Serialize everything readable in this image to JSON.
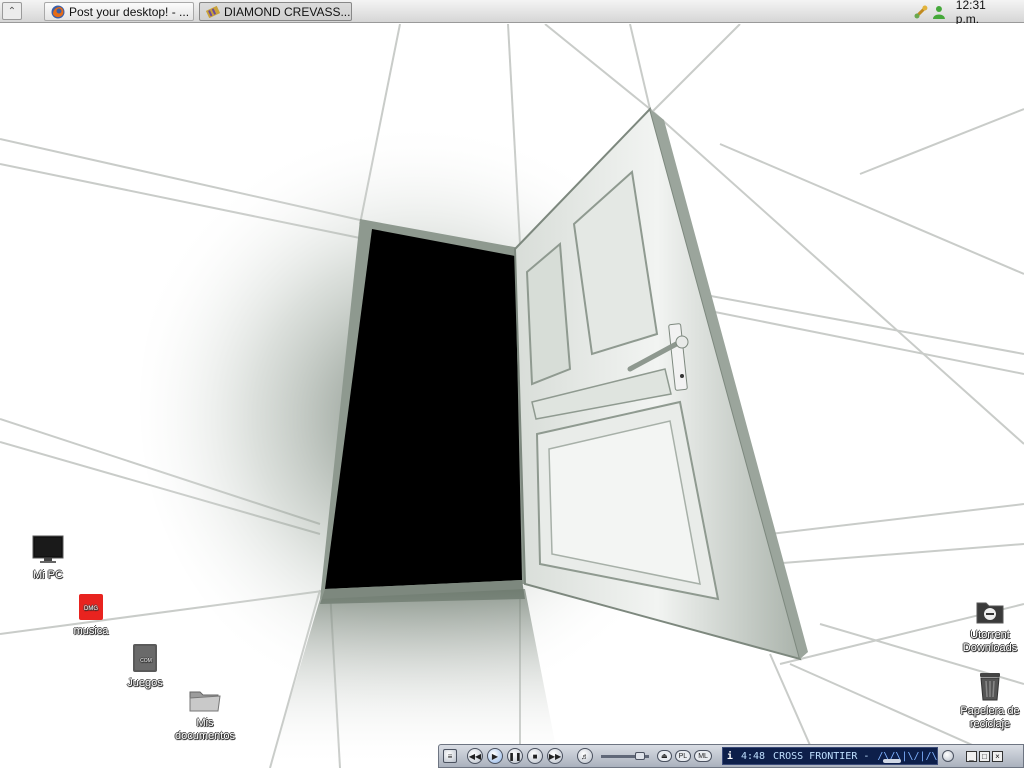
{
  "taskbar": {
    "tasks": [
      {
        "label": "Post your desktop! - ...",
        "icon": "firefox-icon"
      },
      {
        "label": "DIAMOND CREVASS...",
        "icon": "winrar-icon"
      }
    ],
    "clock": "12:31 p.m.",
    "tray_icons": [
      "network-icon",
      "messenger-user-icon"
    ]
  },
  "desktop": {
    "icons_left": [
      {
        "label": "Mi PC",
        "icon": "monitor-icon"
      },
      {
        "label": "musica",
        "icon": "music-folder-icon"
      },
      {
        "label": "Juegos",
        "icon": "games-folder-icon"
      },
      {
        "label": "Mis documentos",
        "icon": "documents-folder-icon"
      }
    ],
    "icons_right": [
      {
        "label": "Utorrent Downloads",
        "icon": "downloads-folder-icon"
      },
      {
        "label": "Papelera de reciclaje",
        "icon": "recycle-bin-icon"
      }
    ]
  },
  "player": {
    "time": "4:48",
    "track": "CROSS FRONTIER -",
    "pl_label": "PL",
    "ml_label": "ML"
  },
  "colors": {
    "taskbar_bg": "#e2e2e2",
    "door_shadow": "#000000",
    "door_tint": "#7d8a7e",
    "lcd_bg": "#0d1f4a"
  }
}
